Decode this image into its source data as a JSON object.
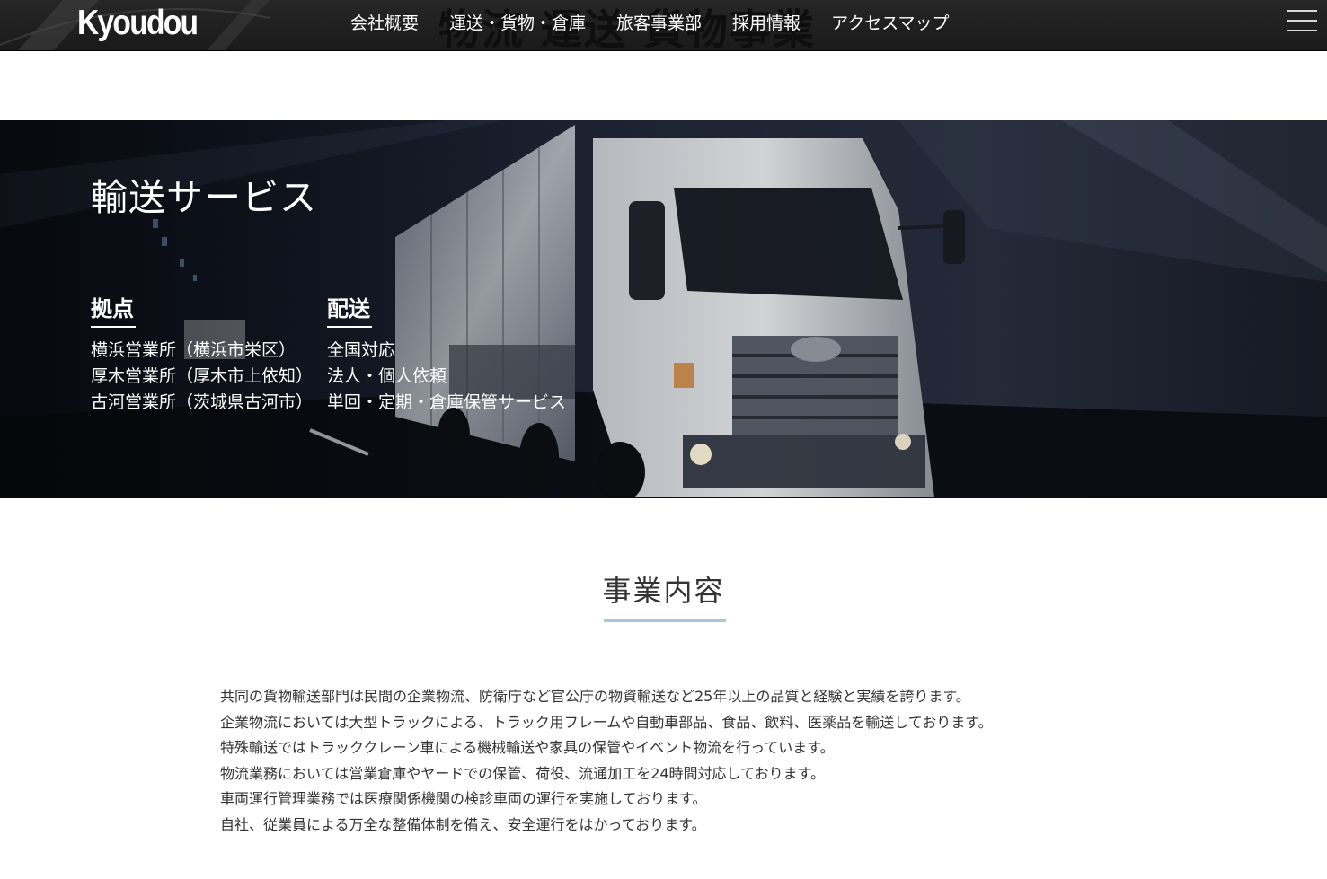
{
  "header": {
    "logo": "Kyoudou",
    "watermark": "物流 運送 貨物事業",
    "nav": [
      "会社概要",
      "運送・貨物・倉庫",
      "旅客事業部",
      "採用情報",
      "アクセスマップ"
    ],
    "menu_icon": "hamburger-icon"
  },
  "hero": {
    "title": "輸送サービス",
    "bases": {
      "heading": "拠点",
      "lines": [
        "横浜営業所（横浜市栄区）",
        "厚木営業所（厚木市上依知）",
        "古河営業所（茨城県古河市）"
      ]
    },
    "delivery": {
      "heading": "配送",
      "lines": [
        "全国対応",
        "法人・個人依頼",
        "単回・定期・倉庫保管サービス"
      ]
    }
  },
  "business": {
    "title": "事業内容",
    "paragraphs": [
      "共同の貨物輸送部門は民間の企業物流、防衛庁など官公庁の物資輸送など25年以上の品質と経験と実績を誇ります。",
      "企業物流においては大型トラックによる、トラック用フレームや自動車部品、食品、飲料、医薬品を輸送しております。",
      "特殊輸送ではトラッククレーン車による機械輸送や家具の保管やイベント物流を行っています。",
      "物流業務においては営業倉庫やヤードでの保管、荷役、流通加工を24時間対応しております。",
      "車両運行管理業務では医療関係機関の検診車両の運行を実施しております。",
      "自社、従業員による万全な整備体制を備え、安全運行をはかっております。"
    ]
  },
  "colors": {
    "header_bg": "#1f1f1f",
    "hero_bg": "#141a26",
    "accent_underline": "#a9c6dd",
    "body_text": "#333333"
  }
}
